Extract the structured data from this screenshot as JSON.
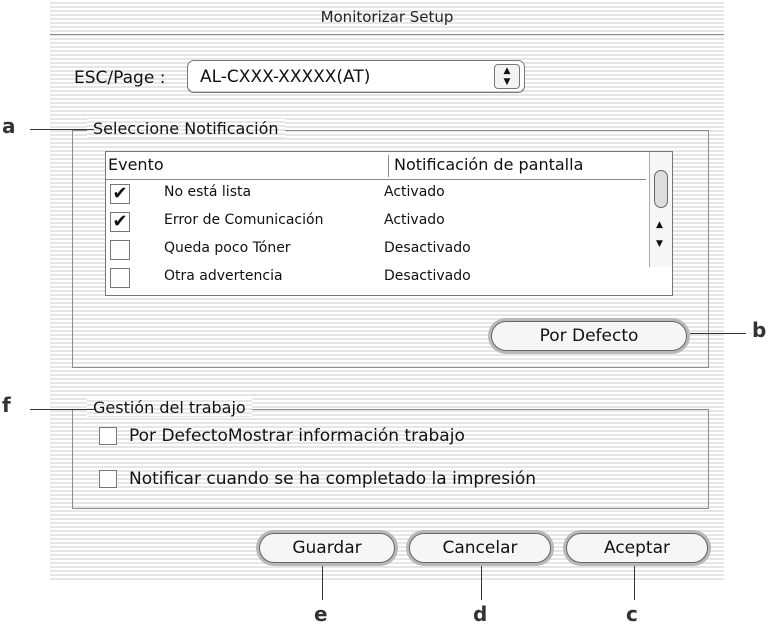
{
  "window": {
    "title": "Monitorizar Setup"
  },
  "printer": {
    "label": "ESC/Page :",
    "selected": "AL-CXXX-XXXXX(AT)"
  },
  "notification_group": {
    "label": "Seleccione Notificación",
    "columns": [
      "Evento",
      "Notificación de pantalla"
    ],
    "rows": [
      {
        "checked": true,
        "event": "No está lista",
        "status": "Activado"
      },
      {
        "checked": true,
        "event": "Error de Comunicación",
        "status": "Activado"
      },
      {
        "checked": false,
        "event": "Queda poco Tóner",
        "status": "Desactivado"
      },
      {
        "checked": false,
        "event": "Otra advertencia",
        "status": "Desactivado"
      }
    ],
    "default_button": "Por Defecto"
  },
  "job_group": {
    "label": "Gestión del trabajo",
    "options": [
      {
        "checked": false,
        "label": "Por DefectoMostrar información trabajo"
      },
      {
        "checked": false,
        "label": "Notificar cuando se ha completado la impresión"
      }
    ]
  },
  "buttons": {
    "save": "Guardar",
    "cancel": "Cancelar",
    "accept": "Aceptar"
  },
  "callouts": {
    "a": "a",
    "b": "b",
    "c": "c",
    "d": "d",
    "e": "e",
    "f": "f"
  }
}
